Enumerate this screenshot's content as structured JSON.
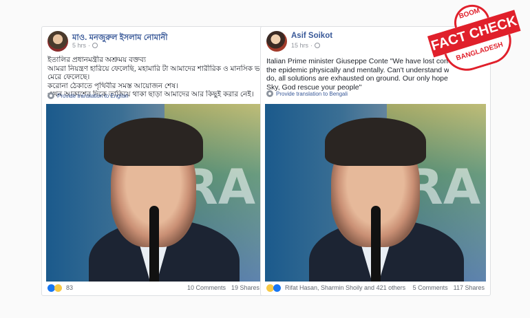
{
  "left_post": {
    "author": "মাও. মনজুরুল ইসলাম নোমানী",
    "time": "5 hrs",
    "lines": [
      "ইতালির প্রধানমন্ত্রীর অশ্রুময় বক্তব্য",
      "আমরা নিয়ন্ত্রণ হারিয়ে ফেলেছি, মহামারি টা আমাদের শারীরিক ও মানসিক ভাবে",
      "মেরে ফেলেছে।",
      "করোনা ঠেকাতে পৃথিবীর সমস্ত আয়োজন শেষ।",
      "এখন আকাশের দিকে তাকিয়ে থাকা ছাড়া আমাদের আর কিছুই করার নেই।"
    ],
    "translate": "Provide translation to English",
    "reaction_count": "83",
    "comments": "10 Comments",
    "shares": "19 Shares"
  },
  "right_post": {
    "author": "Asif Soikot",
    "time": "15 hrs",
    "lines": [
      "Italian Prime minister Giuseppe Conte \"We have lost control,",
      "the epidemic physically and mentally. Can't understand what t",
      "do, all solutions are exhausted on ground. Our only hope remains",
      "Sky, God rescue your people\""
    ],
    "translate": "Provide translation to Bengali",
    "reaction_names": "Rifat Hasan, Sharmin Shoily and 421 others",
    "comments": "5 Comments",
    "shares": "117 Shares"
  },
  "stamp": {
    "top": "BOOM",
    "main": "FACT CHECK",
    "bottom": "BANGLADESH",
    "color": "#e0202b"
  },
  "photo_letter": "RA"
}
